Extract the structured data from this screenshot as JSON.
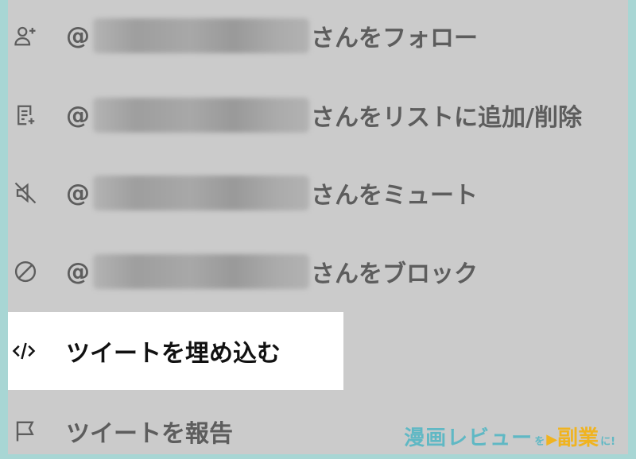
{
  "menu": {
    "items": [
      {
        "icon": "follow-user-icon",
        "prefix": "@",
        "suffix": "さんをフォロー"
      },
      {
        "icon": "add-to-list-icon",
        "prefix": "@",
        "suffix": "さんをリストに追加/削除"
      },
      {
        "icon": "mute-speaker-icon",
        "prefix": "@",
        "suffix": "さんをミュート"
      },
      {
        "icon": "block-icon",
        "prefix": "@",
        "suffix": "さんをブロック"
      },
      {
        "icon": "embed-code-icon",
        "label": "ツイートを埋め込む"
      },
      {
        "icon": "flag-icon",
        "label": "ツイートを報告"
      }
    ]
  },
  "watermark": {
    "main": "漫画レビュー",
    "small1": "を",
    "accent": "副業",
    "small2": "に!"
  },
  "colors": {
    "background": "#a8d6d4",
    "menu_bg": "#cbcbcb",
    "text_dim": "#5d5d5d",
    "highlight_bg": "#ffffff",
    "watermark_teal": "#5fb8c4",
    "watermark_orange": "#f0b31f"
  }
}
